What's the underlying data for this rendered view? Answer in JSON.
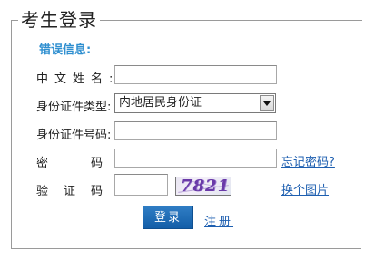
{
  "form": {
    "title": "考生登录",
    "error_label": "错误信息:",
    "name_label": "中文姓名:",
    "id_type_label": "身份证件类型:",
    "id_type_value": "内地居民身份证",
    "id_number_label": "身份证件号码:",
    "password_label": "密　码:",
    "forgot_password_link": "忘记密码?",
    "captcha_label": "验证码:",
    "captcha_image_text": "7821",
    "change_image_link": "换个图片",
    "login_button": "登录",
    "register_link": "注册"
  }
}
